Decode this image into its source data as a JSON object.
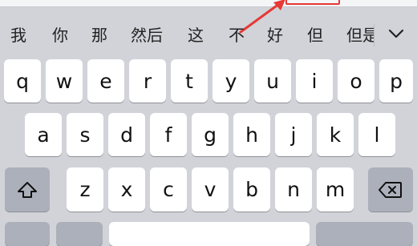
{
  "keyboard": {
    "candidates": [
      "我",
      "你",
      "那",
      "然后",
      "这",
      "不",
      "好",
      "但",
      "但是"
    ],
    "collapse_icon": "chevron-down-icon",
    "rows": [
      [
        "q",
        "w",
        "e",
        "r",
        "t",
        "y",
        "u",
        "i",
        "o",
        "p"
      ],
      [
        "a",
        "s",
        "d",
        "f",
        "g",
        "h",
        "j",
        "k",
        "l"
      ],
      [
        "z",
        "x",
        "c",
        "v",
        "b",
        "n",
        "m"
      ]
    ],
    "shift_icon": "shift-arrow-icon",
    "delete_icon": "backspace-icon",
    "colors": {
      "background": "#d1d3d9",
      "key": "#ffffff",
      "function_key": "#abb0ba",
      "annotation": "#e53935"
    }
  }
}
